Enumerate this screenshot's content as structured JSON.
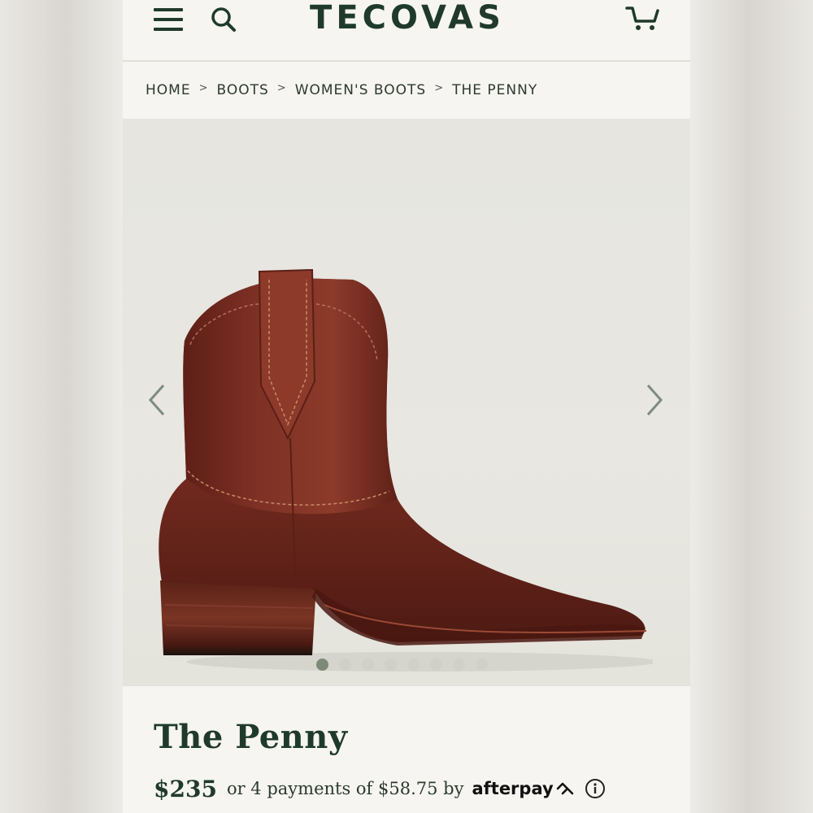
{
  "header": {
    "logo_text": "TECOVAS",
    "menu_icon": "hamburger-menu-icon",
    "search_icon": "search-icon",
    "cart_icon": "cart-icon"
  },
  "breadcrumb": {
    "items": [
      "HOME",
      "BOOTS",
      "WOMEN'S BOOTS",
      "THE PENNY"
    ],
    "separator": ">"
  },
  "gallery": {
    "prev_icon": "chevron-left-icon",
    "next_icon": "chevron-right-icon",
    "image": "brown-leather-ankle-boot",
    "slide_count": 8,
    "active_slide": 1
  },
  "product": {
    "title": "The Penny",
    "price": "$235",
    "installments_text": "or 4 payments of $58.75 by",
    "afterpay_label": "afterpay",
    "info_icon": "info-icon"
  },
  "colors": {
    "brand_green": "#1f3a2b",
    "background": "#f7f5f1",
    "gallery_bg": "#e6e5df",
    "boot_leather": "#7a2e22"
  }
}
